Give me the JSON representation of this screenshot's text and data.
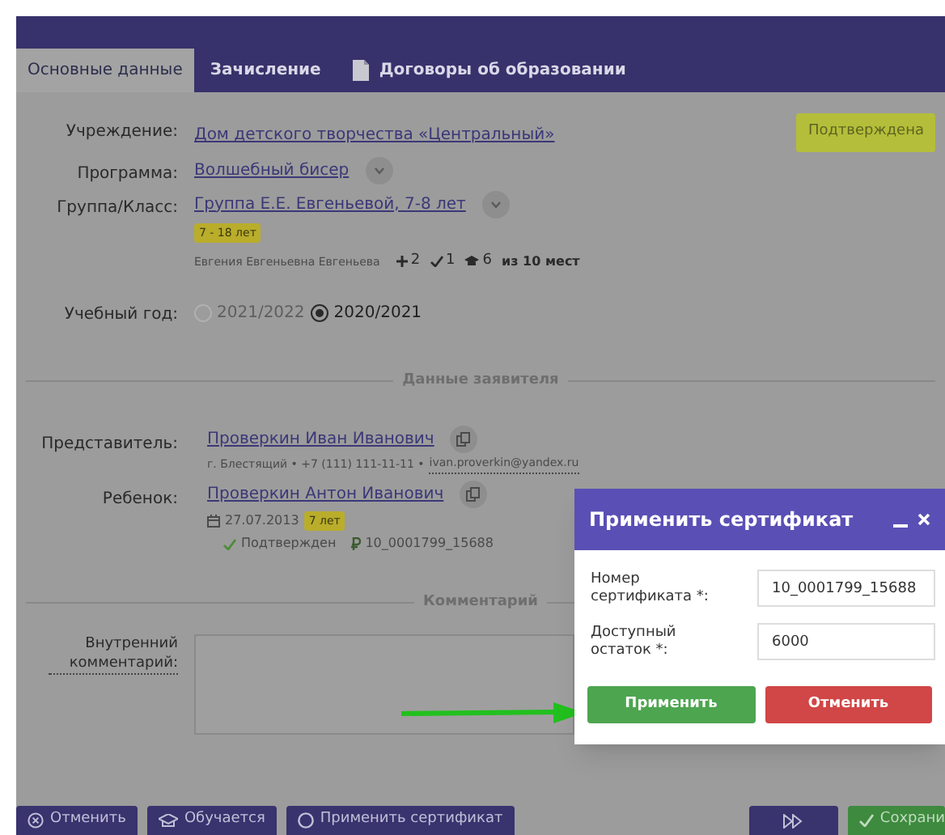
{
  "tabs": [
    {
      "label": "Основные данные",
      "selected": true,
      "has_icon": false
    },
    {
      "label": "Зачисление",
      "selected": false,
      "has_icon": false
    },
    {
      "label": "Договоры об образовании",
      "selected": false,
      "has_icon": true
    }
  ],
  "status_badge": "Подтверждена",
  "institution": {
    "label": "Учреждение:",
    "value": "Дом детского творчества «Центральный»"
  },
  "program": {
    "label": "Программа:",
    "value": "Волшебный бисер"
  },
  "group": {
    "label": "Группа/Класс:",
    "value": "Группа Е.Е. Евгеньевой, 7-8 лет",
    "age_badge": "7 - 18 лет",
    "teacher": "Евгения Евгеньевна Евгеньева",
    "stats": [
      {
        "kind": "plus",
        "text": "2"
      },
      {
        "kind": "check",
        "text": "1"
      },
      {
        "kind": "cap",
        "text": "6"
      }
    ],
    "capacity": "из 10 мест"
  },
  "school_year": {
    "label": "Учебный год:",
    "options": [
      {
        "label": "2021/2022",
        "selected": false,
        "disabled": true
      },
      {
        "label": "2020/2021",
        "selected": true,
        "disabled": false
      }
    ]
  },
  "applicant_section": "Данные заявителя",
  "representative": {
    "label": "Представитель:",
    "name": "Проверкин Иван Иванович",
    "details": "г. Блестящий • +7 (111) 111-11-11 •",
    "email": "ivan.proverkin@yandex.ru"
  },
  "child": {
    "label": "Ребенок:",
    "name": "Проверкин Антон Иванович",
    "birth_date": "27.07.2013",
    "age_badge": "7 лет",
    "status": "Подтвержден",
    "certificate": "10_0001799_15688"
  },
  "comment_section": "Комментарий",
  "internal_comment": {
    "label": "Внутренний комментарий:"
  },
  "footer_buttons": [
    {
      "kind": "cancel",
      "label": "Отменить"
    },
    {
      "kind": "cap",
      "label": "Обучается"
    },
    {
      "kind": "circle",
      "label": "Применить сертификат"
    },
    {
      "kind": "forward"
    },
    {
      "kind": "save",
      "label": "Сохрани"
    }
  ],
  "dialog": {
    "title": "Применить сертификат",
    "fields": [
      {
        "label": "Номер сертификата *:",
        "value": "10_0001799_15688"
      },
      {
        "label": "Доступный остаток *:",
        "value": "6000"
      }
    ],
    "buttons": [
      {
        "kind": "primary",
        "label": "Применить"
      },
      {
        "kind": "danger",
        "label": "Отменить"
      }
    ]
  }
}
